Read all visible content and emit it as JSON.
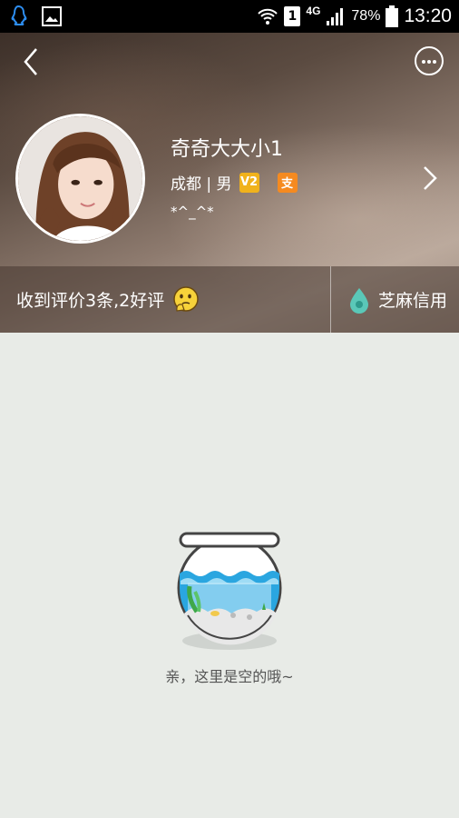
{
  "status_bar": {
    "network": "4G",
    "sim_slot": "1",
    "battery": "78%",
    "time": "13:20"
  },
  "profile": {
    "nickname": "奇奇大大小1",
    "location_gender": "成都 | 男",
    "badge_v": "V2",
    "badge_alipay": "支",
    "signature": "*^_^*"
  },
  "stats": {
    "rating_text": "收到评价3条,2好评",
    "credit_text": "芝麻信用"
  },
  "empty_state": {
    "message": "亲，这里是空的哦~"
  },
  "colors": {
    "badge_v": "#f0b21c",
    "badge_alipay": "#f58a20",
    "credit_drop": "#5ac8b8",
    "background": "#e8ebe7"
  }
}
